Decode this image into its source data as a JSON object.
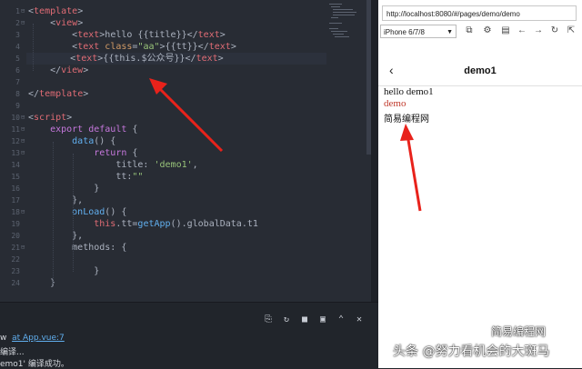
{
  "editor": {
    "lines": [
      {
        "n": "1",
        "fold": "⊟",
        "parts": [
          {
            "t": "<",
            "c": "#abb2bf"
          },
          {
            "t": "template",
            "c": "#e06c75"
          },
          {
            "t": ">",
            "c": "#abb2bf"
          }
        ]
      },
      {
        "n": "2",
        "fold": "⊟",
        "parts": [
          {
            "t": "    <",
            "c": "#abb2bf"
          },
          {
            "t": "view",
            "c": "#e06c75"
          },
          {
            "t": ">",
            "c": "#abb2bf"
          }
        ]
      },
      {
        "n": "3",
        "fold": "",
        "parts": [
          {
            "t": "        <",
            "c": "#abb2bf"
          },
          {
            "t": "text",
            "c": "#e06c75"
          },
          {
            "t": ">hello {{title}}</",
            "c": "#abb2bf"
          },
          {
            "t": "text",
            "c": "#e06c75"
          },
          {
            "t": ">",
            "c": "#abb2bf"
          }
        ]
      },
      {
        "n": "4",
        "fold": "",
        "parts": [
          {
            "t": "        <",
            "c": "#abb2bf"
          },
          {
            "t": "text",
            "c": "#e06c75"
          },
          {
            "t": " class",
            "c": "#d19a66"
          },
          {
            "t": "=",
            "c": "#abb2bf"
          },
          {
            "t": "\"aa\"",
            "c": "#98c379"
          },
          {
            "t": ">{{tt}}</",
            "c": "#abb2bf"
          },
          {
            "t": "text",
            "c": "#e06c75"
          },
          {
            "t": ">",
            "c": "#abb2bf"
          }
        ]
      },
      {
        "n": "5",
        "fold": "",
        "parts": [
          {
            "t": "        <",
            "c": "#abb2bf"
          },
          {
            "t": "text",
            "c": "#e06c75"
          },
          {
            "t": ">{{this.$公众号}}</",
            "c": "#abb2bf"
          },
          {
            "t": "text",
            "c": "#e06c75"
          },
          {
            "t": ">",
            "c": "#abb2bf"
          }
        ]
      },
      {
        "n": "6",
        "fold": "",
        "parts": [
          {
            "t": "    </",
            "c": "#abb2bf"
          },
          {
            "t": "view",
            "c": "#e06c75"
          },
          {
            "t": ">",
            "c": "#abb2bf"
          }
        ]
      },
      {
        "n": "7",
        "fold": "",
        "parts": []
      },
      {
        "n": "8",
        "fold": "",
        "parts": [
          {
            "t": "</",
            "c": "#abb2bf"
          },
          {
            "t": "template",
            "c": "#e06c75"
          },
          {
            "t": ">",
            "c": "#abb2bf"
          }
        ]
      },
      {
        "n": "9",
        "fold": "",
        "parts": []
      },
      {
        "n": "10",
        "fold": "⊟",
        "parts": [
          {
            "t": "<",
            "c": "#abb2bf"
          },
          {
            "t": "script",
            "c": "#e06c75"
          },
          {
            "t": ">",
            "c": "#abb2bf"
          }
        ]
      },
      {
        "n": "11",
        "fold": "⊟",
        "parts": [
          {
            "t": "    export default",
            "c": "#c678dd"
          },
          {
            "t": " {",
            "c": "#abb2bf"
          }
        ]
      },
      {
        "n": "12",
        "fold": "⊟",
        "parts": [
          {
            "t": "        data",
            "c": "#61afef"
          },
          {
            "t": "() {",
            "c": "#abb2bf"
          }
        ]
      },
      {
        "n": "13",
        "fold": "⊟",
        "parts": [
          {
            "t": "            return",
            "c": "#c678dd"
          },
          {
            "t": " {",
            "c": "#abb2bf"
          }
        ]
      },
      {
        "n": "14",
        "fold": "",
        "parts": [
          {
            "t": "                title: ",
            "c": "#abb2bf"
          },
          {
            "t": "'demo1'",
            "c": "#98c379"
          },
          {
            "t": ",",
            "c": "#abb2bf"
          }
        ]
      },
      {
        "n": "15",
        "fold": "",
        "parts": [
          {
            "t": "                tt:",
            "c": "#abb2bf"
          },
          {
            "t": "\"\"",
            "c": "#98c379"
          }
        ]
      },
      {
        "n": "16",
        "fold": "",
        "parts": [
          {
            "t": "            }",
            "c": "#abb2bf"
          }
        ]
      },
      {
        "n": "17",
        "fold": "",
        "parts": [
          {
            "t": "        },",
            "c": "#abb2bf"
          }
        ]
      },
      {
        "n": "18",
        "fold": "⊟",
        "parts": [
          {
            "t": "        onLoad",
            "c": "#61afef"
          },
          {
            "t": "() {",
            "c": "#abb2bf"
          }
        ]
      },
      {
        "n": "19",
        "fold": "",
        "parts": [
          {
            "t": "            this",
            "c": "#e06c75"
          },
          {
            "t": ".tt=",
            "c": "#abb2bf"
          },
          {
            "t": "getApp",
            "c": "#61afef"
          },
          {
            "t": "().globalData.t1",
            "c": "#abb2bf"
          }
        ]
      },
      {
        "n": "20",
        "fold": "",
        "parts": [
          {
            "t": "        },",
            "c": "#abb2bf"
          }
        ]
      },
      {
        "n": "21",
        "fold": "⊟",
        "parts": [
          {
            "t": "        methods: {",
            "c": "#abb2bf"
          }
        ]
      },
      {
        "n": "22",
        "fold": "",
        "parts": []
      },
      {
        "n": "23",
        "fold": "",
        "parts": [
          {
            "t": "            }",
            "c": "#abb2bf"
          }
        ]
      },
      {
        "n": "24",
        "fold": "",
        "parts": [
          {
            "t": "    }",
            "c": "#abb2bf"
          }
        ]
      }
    ]
  },
  "console": {
    "line1_prefix": "w",
    "line1_link": "at App.vue:7",
    "line2": "编译...",
    "line3": "emo1' 编译成功。"
  },
  "console_tools": [
    "clear-icon",
    "restart-icon",
    "stop-icon",
    "maximize-icon",
    "chevron-up-icon",
    "close-icon"
  ],
  "preview": {
    "url": "http://localhost:8080/#/pages/demo/demo",
    "device": "iPhone 6/7/8",
    "nav_title": "demo1",
    "line1": "hello demo1",
    "line2": "demo",
    "line3": "简易编程网",
    "accent": "#c0392b"
  },
  "watermarks": {
    "top": "简易编程网",
    "bottom": "头条 @努力看机会的大斑马"
  },
  "colors": {
    "editor_bg": "#282c34",
    "arrow": "#e8221b"
  }
}
